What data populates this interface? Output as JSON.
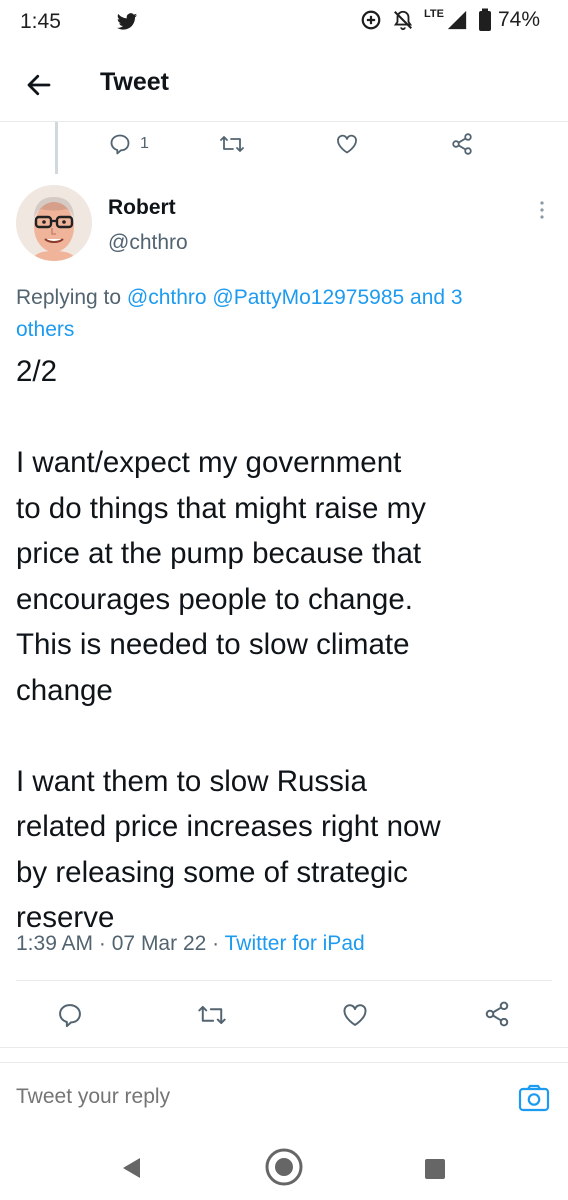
{
  "status_bar": {
    "time": "1:45",
    "network": "LTE",
    "battery": "74%",
    "icons": [
      "twitter-icon",
      "data-saver-icon",
      "mute-icon",
      "signal-icon",
      "battery-icon"
    ]
  },
  "header": {
    "title": "Tweet",
    "back_icon": "arrow-left-icon"
  },
  "prev_tweet_actions": {
    "reply_count": "1"
  },
  "tweet": {
    "author_name": "Robert",
    "author_handle": "@chthro",
    "replying_prefix": "Replying to",
    "replying_mentions": "@chthro @PattyMo12975985 and 3",
    "replying_mentions_cont": "others",
    "body": {
      "line1": "2/2",
      "line2": "I want/expect my government",
      "line3": "to do things that might raise my",
      "line4": "price at the pump because that",
      "line5": "encourages people to change.",
      "line6": "This is needed to slow climate",
      "line7": "change",
      "line8": "I want them to slow Russia",
      "line9": "related price increases right now",
      "line10": "by releasing some of strategic",
      "line11": "reserve"
    },
    "meta": {
      "time": "1:39 AM",
      "separator": "·",
      "date": "07 Mar 22",
      "separator2": "·",
      "source": "Twitter for iPad"
    }
  },
  "reply_bar": {
    "placeholder": "Tweet your reply"
  },
  "colors": {
    "accent": "#1d9bf0",
    "text_primary": "#0f1419",
    "text_secondary": "#536471",
    "divider": "#e7e9ea"
  }
}
